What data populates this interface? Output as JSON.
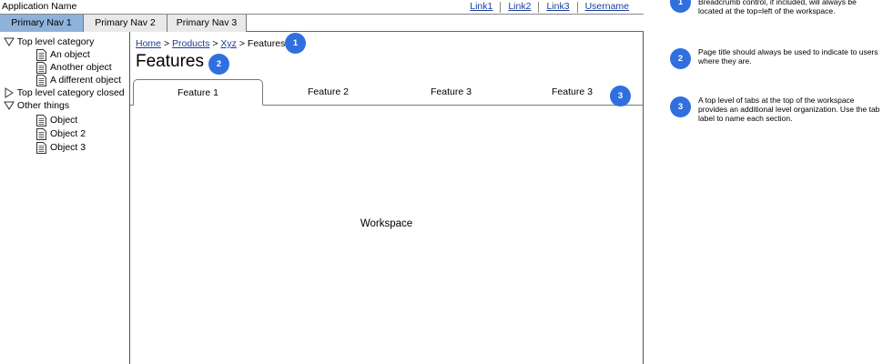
{
  "app": {
    "name": "Application Name",
    "links": [
      "Link1",
      "Link2",
      "Link3",
      "Username"
    ]
  },
  "primary_nav": {
    "items": [
      "Primary Nav 1",
      "Primary Nav 2",
      "Primary Nav 3"
    ],
    "active": "Primary Nav 1",
    "active_color": "#8fb2da"
  },
  "tree": {
    "top_category": "Top level category",
    "top_children": [
      "An object",
      "Another object",
      "A different object"
    ],
    "closed_category": "Top level category closed",
    "other_category": "Other things",
    "other_children": [
      "Object",
      "Object 2",
      "Object 3"
    ]
  },
  "breadcrumb": {
    "links": [
      "Home",
      "Products",
      "Xyz"
    ],
    "separator": ">",
    "current": "Features"
  },
  "page_title": "Features",
  "tabs": {
    "items": [
      "Feature 1",
      "Feature 2",
      "Feature 3",
      "Feature 3"
    ],
    "active": "Feature 1"
  },
  "workspace_label": "Workspace",
  "badges": [
    "1",
    "2",
    "3"
  ],
  "badge_color": "#2f6fe0",
  "annotations": [
    {
      "number": "1",
      "text": "Breadcrumb control, if included, will always be located at the top=left of the workspace."
    },
    {
      "number": "2",
      "text": "Page title should always be used to indicate to users where they are."
    },
    {
      "number": "3",
      "text": "A top level of tabs at the top of the workspace provides an additional level organization.  Use the tab label to name each section."
    }
  ]
}
